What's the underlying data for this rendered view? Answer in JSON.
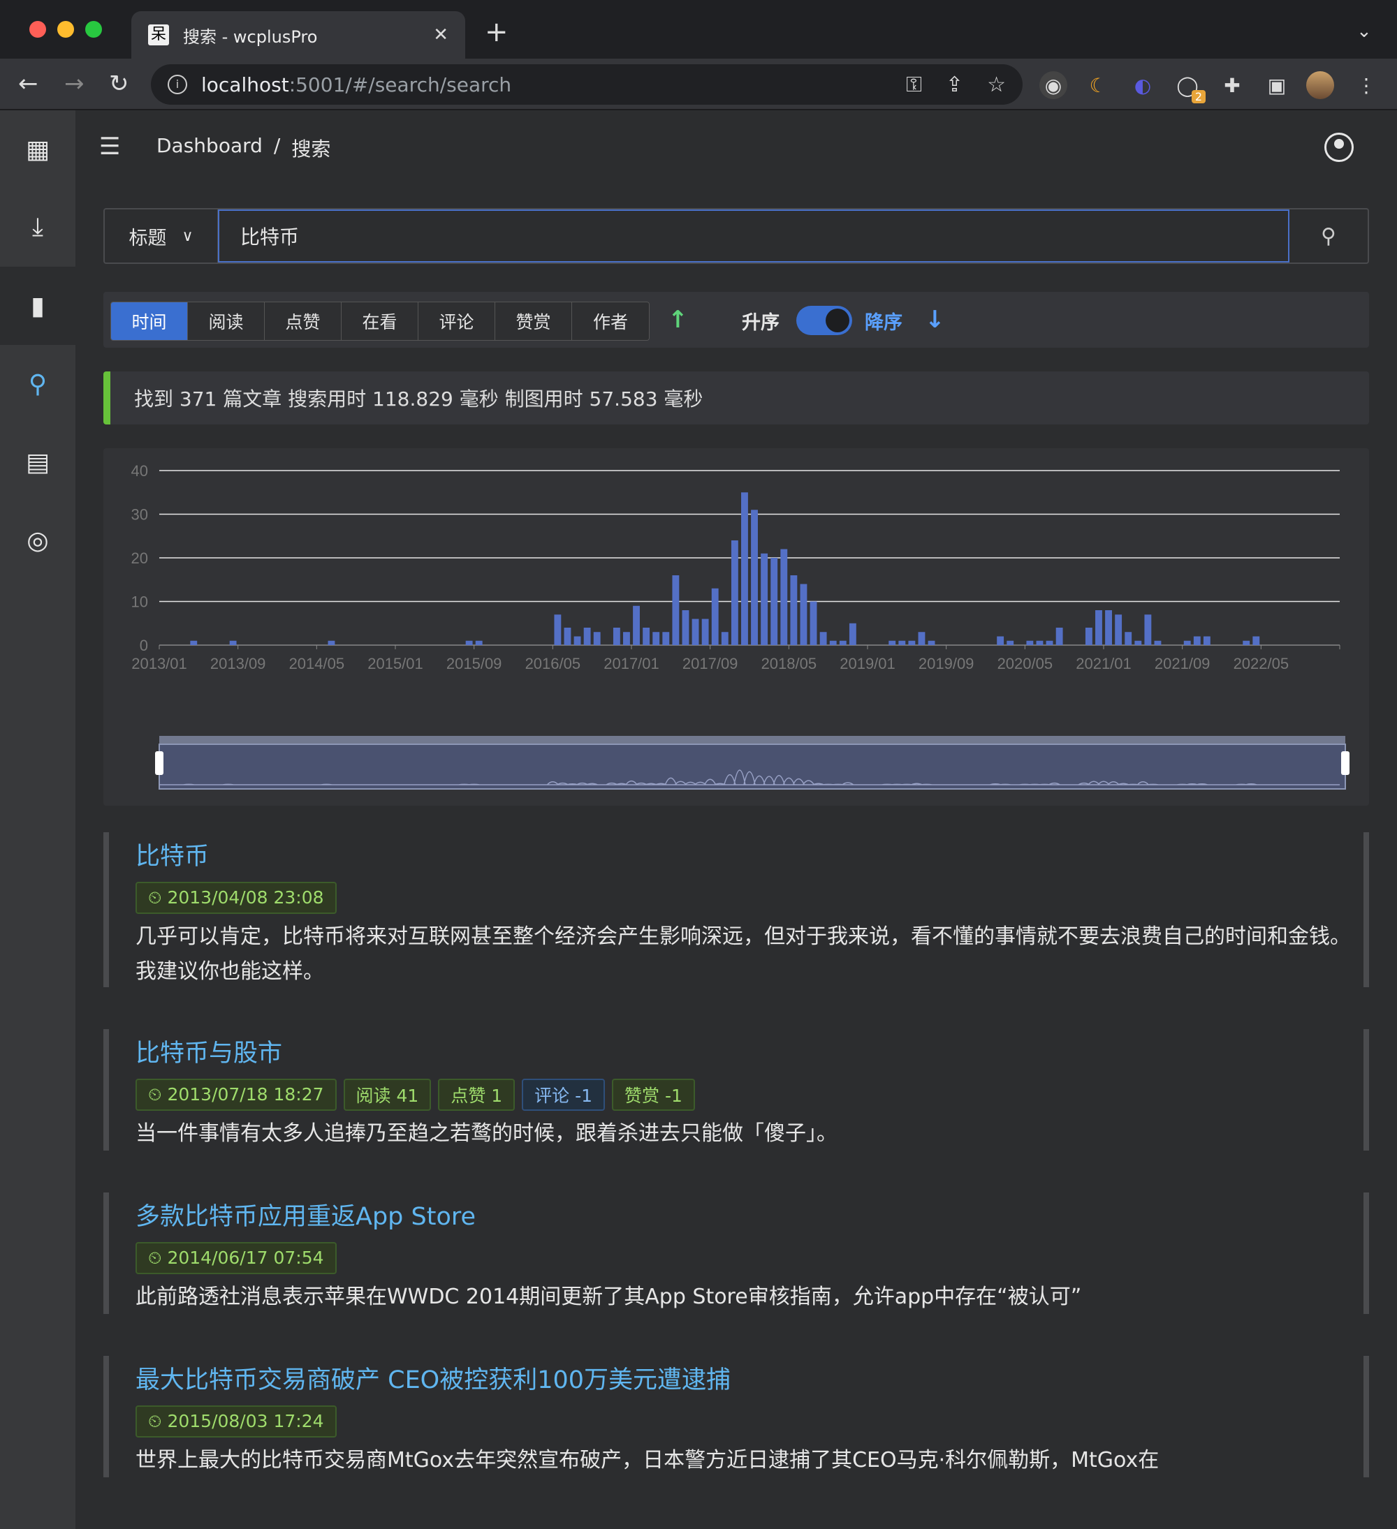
{
  "browser": {
    "tab_title": "搜索 - wcplusPro",
    "tab_favicon": "呆",
    "url_host": "localhost",
    "url_rest": ":5001/#/search/search",
    "extension_badge": "2"
  },
  "breadcrumb": {
    "root": "Dashboard",
    "sep": "/",
    "current": "搜索"
  },
  "search": {
    "field": "标题",
    "query": "比特币"
  },
  "sort": {
    "options": [
      "时间",
      "阅读",
      "点赞",
      "在看",
      "评论",
      "赞赏",
      "作者"
    ],
    "active": "时间",
    "asc_label": "升序",
    "desc_label": "降序"
  },
  "stats_text": "找到 371 篇文章 搜索用时 118.829 毫秒 制图用时 57.583 毫秒",
  "chart_data": {
    "type": "bar",
    "ylim": [
      0,
      40
    ],
    "yticks": [
      0,
      10,
      20,
      30,
      40
    ],
    "xtick_labels": [
      "2013/01",
      "2013/09",
      "2014/05",
      "2015/01",
      "2015/09",
      "2016/05",
      "2017/01",
      "2017/09",
      "2018/05",
      "2019/01",
      "2019/09",
      "2020/05",
      "2021/01",
      "2021/09",
      "2022/05"
    ],
    "x_start": "2013/01",
    "x_end": "2023/01",
    "grid": true,
    "bar_color": "#5470c6",
    "series": [
      {
        "values": [
          0,
          0,
          0,
          1,
          0,
          0,
          0,
          1,
          0,
          0,
          0,
          0,
          0,
          0,
          0,
          0,
          0,
          1,
          0,
          0,
          0,
          0,
          0,
          0,
          0,
          0,
          0,
          0,
          0,
          0,
          0,
          0,
          0,
          0,
          0,
          0,
          0,
          0,
          0,
          0,
          0,
          0,
          0,
          0,
          0,
          0,
          0,
          0,
          0,
          0,
          0,
          0,
          0,
          0,
          0,
          0,
          0,
          0,
          0,
          0,
          0,
          0,
          0,
          0,
          0,
          0,
          0,
          0,
          0,
          0,
          0,
          0,
          0,
          0,
          0,
          0,
          0,
          0,
          0,
          0,
          0,
          0,
          0,
          0,
          0,
          0,
          0,
          0,
          0,
          0,
          0,
          0,
          0,
          0,
          0,
          0,
          0,
          0,
          0,
          0,
          0,
          0,
          0,
          0,
          0,
          0,
          0,
          0,
          0,
          0,
          0,
          0,
          0,
          0,
          0,
          0,
          0,
          0,
          0,
          0,
          0,
          0,
          0,
          0,
          0,
          0,
          0,
          0,
          0,
          0,
          0,
          0,
          0,
          0,
          0,
          0,
          0,
          0,
          0,
          0,
          0,
          0,
          0,
          0,
          0,
          0,
          0,
          0,
          0,
          0,
          0,
          0,
          0,
          0,
          0,
          0,
          0,
          0,
          0,
          0,
          0,
          0,
          0,
          0,
          0,
          0,
          0,
          0,
          0,
          0,
          0,
          0,
          0,
          0,
          0,
          0,
          0,
          0,
          0,
          0,
          0,
          0,
          0,
          0,
          0,
          0,
          0,
          0,
          0,
          0,
          0,
          0,
          0,
          0,
          0,
          0,
          0,
          0,
          0,
          0,
          0,
          0,
          0,
          0,
          0,
          0,
          0,
          0,
          0,
          0,
          0,
          0,
          0,
          0,
          0,
          0,
          0,
          0,
          0,
          0,
          0,
          0,
          0,
          0,
          0,
          0,
          0,
          0,
          0,
          0,
          0,
          0,
          0,
          0,
          0,
          0,
          0,
          0,
          0,
          0,
          0,
          0,
          0,
          0,
          0,
          0,
          0,
          0,
          0,
          0,
          0,
          0,
          0,
          0,
          0,
          0,
          0,
          0,
          0,
          0,
          0,
          0,
          0,
          0,
          0,
          0,
          0,
          0,
          0,
          0,
          0,
          0,
          0,
          0,
          0,
          0,
          0,
          0,
          0,
          0,
          0,
          0,
          0,
          0,
          0,
          0,
          0,
          0
        ]
      }
    ],
    "monthly": [
      [
        "2013/04",
        1
      ],
      [
        "2013/08",
        1
      ],
      [
        "2014/06",
        1
      ],
      [
        "2015/08",
        1
      ],
      [
        "2015/09",
        1
      ],
      [
        "2016/05",
        7
      ],
      [
        "2016/06",
        4
      ],
      [
        "2016/07",
        2
      ],
      [
        "2016/08",
        4
      ],
      [
        "2016/09",
        3
      ],
      [
        "2016/11",
        4
      ],
      [
        "2016/12",
        3
      ],
      [
        "2017/01",
        9
      ],
      [
        "2017/02",
        4
      ],
      [
        "2017/03",
        3
      ],
      [
        "2017/04",
        3
      ],
      [
        "2017/05",
        16
      ],
      [
        "2017/06",
        8
      ],
      [
        "2017/07",
        6
      ],
      [
        "2017/08",
        6
      ],
      [
        "2017/09",
        13
      ],
      [
        "2017/10",
        3
      ],
      [
        "2017/11",
        24
      ],
      [
        "2017/12",
        35
      ],
      [
        "2018/01",
        31
      ],
      [
        "2018/02",
        21
      ],
      [
        "2018/03",
        20
      ],
      [
        "2018/04",
        22
      ],
      [
        "2018/05",
        16
      ],
      [
        "2018/06",
        14
      ],
      [
        "2018/07",
        10
      ],
      [
        "2018/08",
        3
      ],
      [
        "2018/09",
        1
      ],
      [
        "2018/10",
        1
      ],
      [
        "2018/11",
        5
      ],
      [
        "2019/03",
        1
      ],
      [
        "2019/04",
        1
      ],
      [
        "2019/05",
        1
      ],
      [
        "2019/06",
        3
      ],
      [
        "2019/07",
        1
      ],
      [
        "2020/02",
        2
      ],
      [
        "2020/03",
        1
      ],
      [
        "2020/05",
        1
      ],
      [
        "2020/06",
        1
      ],
      [
        "2020/07",
        1
      ],
      [
        "2020/08",
        4
      ],
      [
        "2020/11",
        4
      ],
      [
        "2020/12",
        8
      ],
      [
        "2021/01",
        8
      ],
      [
        "2021/02",
        7
      ],
      [
        "2021/03",
        3
      ],
      [
        "2021/04",
        1
      ],
      [
        "2021/05",
        7
      ],
      [
        "2021/06",
        1
      ],
      [
        "2021/09",
        1
      ],
      [
        "2021/10",
        2
      ],
      [
        "2021/11",
        2
      ],
      [
        "2022/03",
        1
      ],
      [
        "2022/04",
        2
      ]
    ]
  },
  "articles": [
    {
      "title": "比特币",
      "date": "2013/04/08 23:08",
      "tags": [],
      "desc": "几乎可以肯定，比特币将来对互联网甚至整个经济会产生影响深远，但对于我来说，看不懂的事情就不要去浪费自己的时间和金钱。我建议你也能这样。"
    },
    {
      "title": "比特币与股市",
      "date": "2013/07/18 18:27",
      "tags": [
        {
          "text": "阅读 41",
          "kind": "g"
        },
        {
          "text": "点赞 1",
          "kind": "g"
        },
        {
          "text": "评论 -1",
          "kind": "b"
        },
        {
          "text": "赞赏 -1",
          "kind": "g"
        }
      ],
      "desc": "当一件事情有太多人追捧乃至趋之若鹜的时候，跟着杀进去只能做「傻子」。"
    },
    {
      "title": "多款比特币应用重返App Store",
      "date": "2014/06/17 07:54",
      "tags": [],
      "desc": "此前路透社消息表示苹果在WWDC 2014期间更新了其App Store审核指南，允许app中存在“被认可”"
    },
    {
      "title": "最大比特币交易商破产 CEO被控获利100万美元遭逮捕",
      "date": "2015/08/03 17:24",
      "tags": [],
      "desc": "世界上最大的比特币交易商MtGox去年突然宣布破产，日本警方近日逮捕了其CEO马克·科尔佩勒斯，MtGox在"
    }
  ]
}
